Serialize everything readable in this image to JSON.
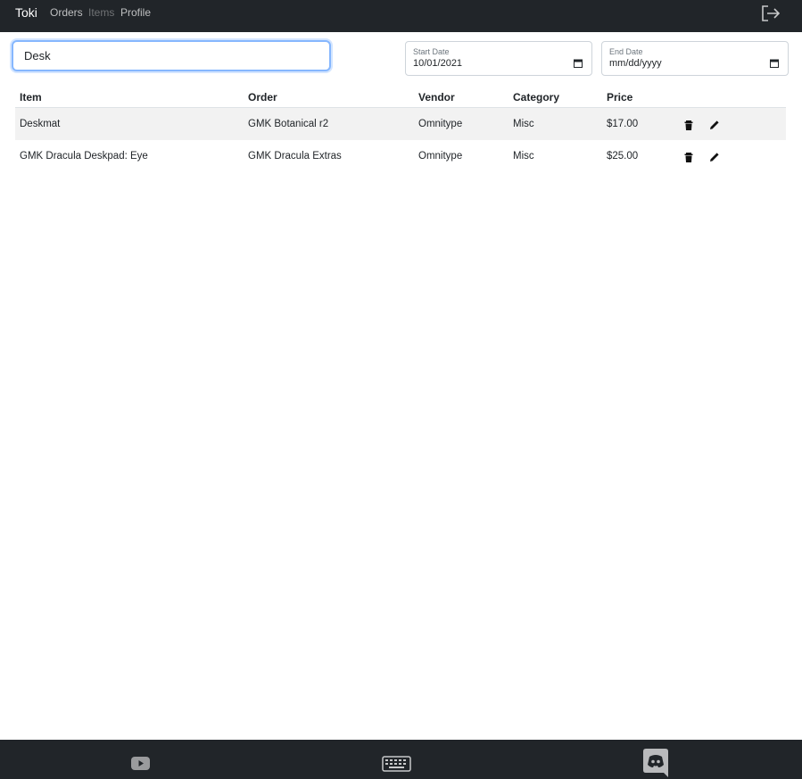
{
  "navbar": {
    "brand": "Toki",
    "links": [
      {
        "label": "Orders",
        "active": false
      },
      {
        "label": "Items",
        "active": true
      },
      {
        "label": "Profile",
        "active": false
      }
    ],
    "logout_icon": "logout-icon"
  },
  "search": {
    "value": "Desk"
  },
  "filters": {
    "start_date": {
      "label": "Start Date",
      "value": "10/01/2021"
    },
    "end_date": {
      "label": "End Date",
      "value": "mm/dd/yyyy"
    }
  },
  "table": {
    "headers": [
      "Item",
      "Order",
      "Vendor",
      "Category",
      "Price"
    ],
    "rows": [
      {
        "item": "Deskmat",
        "order": "GMK Botanical r2",
        "vendor": "Omnitype",
        "category": "Misc",
        "price": "$17.00"
      },
      {
        "item": "GMK Dracula Deskpad: Eye",
        "order": "GMK Dracula Extras",
        "vendor": "Omnitype",
        "category": "Misc",
        "price": "$25.00"
      }
    ],
    "row_actions": [
      "trash-icon",
      "pencil-icon"
    ]
  },
  "footer": {
    "icons": [
      "youtube-icon",
      "keyboard-icon",
      "discord-icon"
    ]
  },
  "colors": {
    "navbar_bg": "#212529",
    "stripe": "#f2f2f2",
    "focus_border": "#86b7fe"
  }
}
